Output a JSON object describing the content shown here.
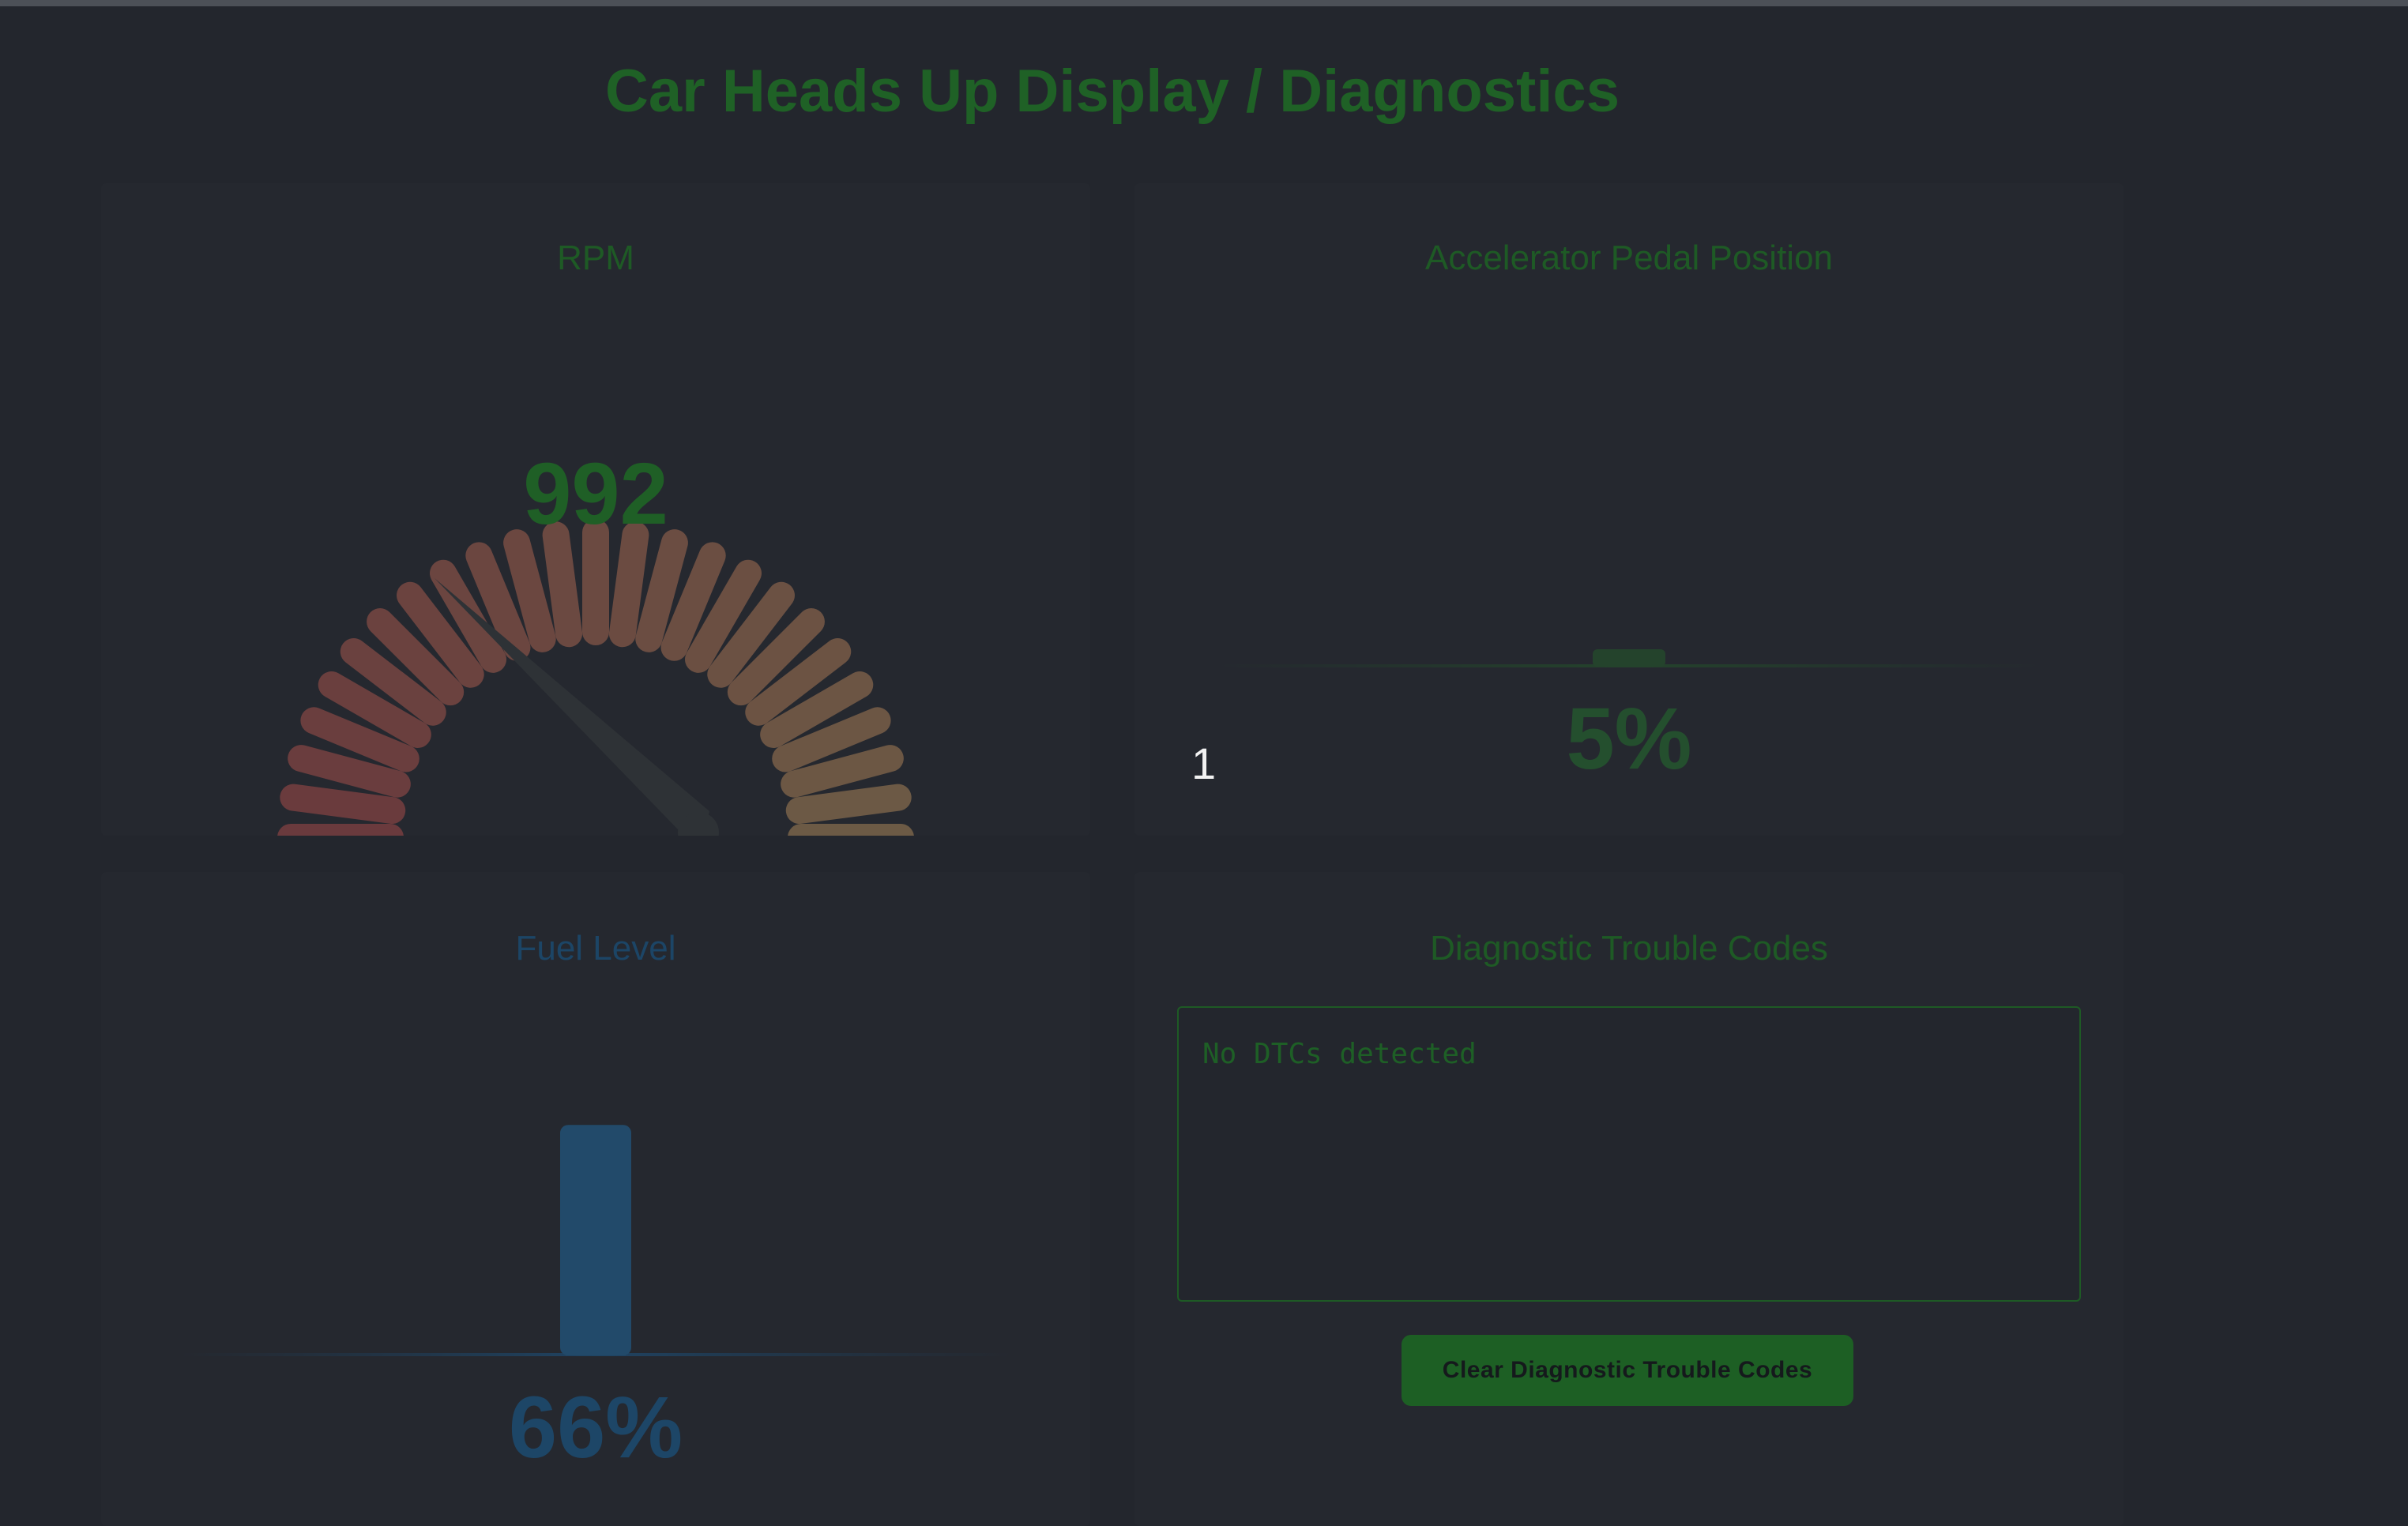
{
  "page": {
    "title": "Car Heads Up Display / Diagnostics"
  },
  "rpm": {
    "title": "RPM",
    "value": "992",
    "segment_count": 25
  },
  "accelerator": {
    "title": "Accelerator Pedal Position",
    "value": "5%",
    "position_fraction": 0.5,
    "index_label": "1"
  },
  "fuel": {
    "title": "Fuel Level",
    "value": "66%",
    "level_fraction": 0.66
  },
  "dtc": {
    "title": "Diagnostic Trouble Codes",
    "codes_text": "No DTCs detected",
    "clear_label": "Clear Diagnostic Trouble Codes"
  },
  "colors": {
    "accent_green": "#1f6126",
    "fuel_blue": "#224a6a",
    "gauge_low": "#6a3a3d",
    "gauge_high": "#6c5a45",
    "background": "#23262d"
  }
}
